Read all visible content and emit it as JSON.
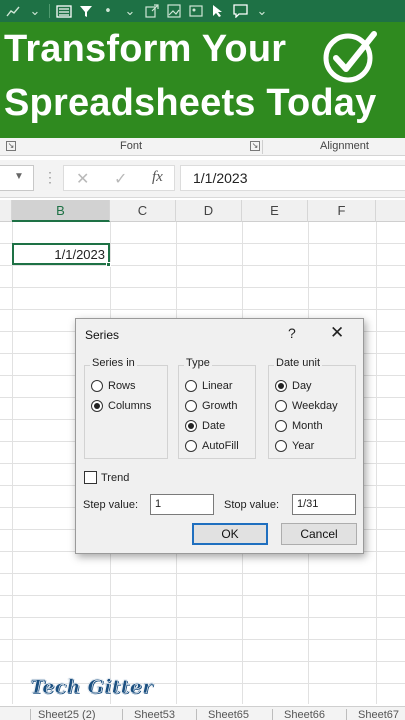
{
  "banner": {
    "line1": "Transform Your",
    "line2": "Spreadsheets Today",
    "check_icon": "check-circle-icon",
    "bg_color": "#2f8a1f"
  },
  "quick_access": {
    "icons": [
      "chart-icon",
      "dropdown-arrow-icon",
      "form-icon",
      "filter-icon",
      "dot-icon",
      "dropdown-arrow-icon",
      "export-icon",
      "image-icon",
      "picture-icon",
      "pointer-icon",
      "comment-icon",
      "dropdown-arrow-icon"
    ]
  },
  "ribbon": {
    "font_group": "Font",
    "alignment_group": "Alignment"
  },
  "formula_bar": {
    "fx_label": "fx",
    "value": "1/1/2023"
  },
  "grid": {
    "columns": [
      "B",
      "C",
      "D",
      "E",
      "F"
    ],
    "selected_column": "B",
    "active_cell_value": "1/1/2023"
  },
  "dialog": {
    "title": "Series",
    "help_label": "?",
    "close_label": "✕",
    "series_in": {
      "title": "Series in",
      "options": [
        {
          "label": "Rows",
          "selected": false
        },
        {
          "label": "Columns",
          "selected": true
        }
      ]
    },
    "type": {
      "title": "Type",
      "options": [
        {
          "label": "Linear",
          "selected": false
        },
        {
          "label": "Growth",
          "selected": false
        },
        {
          "label": "Date",
          "selected": true
        },
        {
          "label": "AutoFill",
          "selected": false
        }
      ]
    },
    "date_unit": {
      "title": "Date unit",
      "options": [
        {
          "label": "Day",
          "selected": true
        },
        {
          "label": "Weekday",
          "selected": false
        },
        {
          "label": "Month",
          "selected": false
        },
        {
          "label": "Year",
          "selected": false
        }
      ]
    },
    "trend": {
      "label": "Trend",
      "checked": false
    },
    "step_value": {
      "label": "Step value:",
      "value": "1"
    },
    "stop_value": {
      "label": "Stop value:",
      "value": "1/31"
    },
    "ok_label": "OK",
    "cancel_label": "Cancel"
  },
  "watermark": "Tech Gitter",
  "sheet_tabs": [
    "Sheet25 (2)",
    "Sheet53",
    "Sheet65",
    "Sheet66",
    "Sheet67"
  ],
  "colors": {
    "excel_green": "#1e7145",
    "dialog_bg": "#f0f0f0",
    "default_button_border": "#1f6fbf"
  }
}
